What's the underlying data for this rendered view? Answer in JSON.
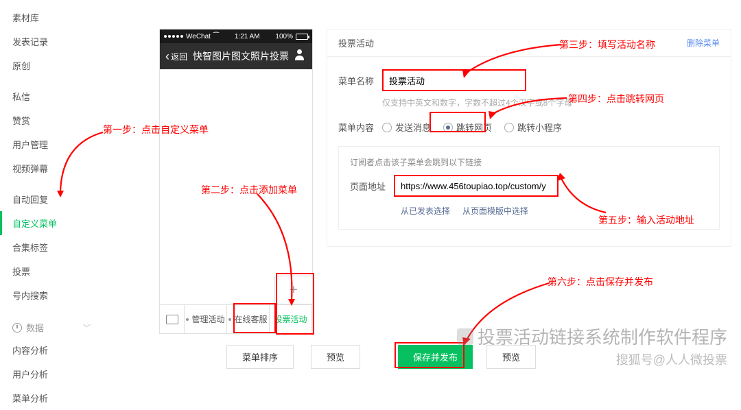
{
  "sidebar": {
    "items": [
      {
        "label": "素材库"
      },
      {
        "label": "发表记录"
      },
      {
        "label": "原创"
      },
      {
        "label": "私信"
      },
      {
        "label": "赞赏"
      },
      {
        "label": "用户管理"
      },
      {
        "label": "视频弹幕"
      },
      {
        "label": "自动回复"
      },
      {
        "label": "自定义菜单"
      },
      {
        "label": "合集标签"
      },
      {
        "label": "投票"
      },
      {
        "label": "号内搜索"
      }
    ],
    "data_section": "数据",
    "data_items": [
      {
        "label": "内容分析"
      },
      {
        "label": "用户分析"
      },
      {
        "label": "菜单分析"
      }
    ]
  },
  "phone": {
    "carrier": "WeChat",
    "time": "1:21 AM",
    "battery": "100%",
    "back": "返回",
    "title": "快智图片图文照片投票",
    "menu_items": [
      "管理活动",
      "在线客服",
      "投票活动"
    ],
    "plus": "+"
  },
  "panel": {
    "title": "投票活动",
    "delete": "删除菜单",
    "name_label": "菜单名称",
    "name_value": "投票活动",
    "name_hint": "仅支持中英文和数字，字数不超过4个汉字或8个字母",
    "content_label": "菜单内容",
    "radio_send": "发送消息",
    "radio_jump": "跳转网页",
    "radio_mini": "跳转小程序",
    "link_hint": "订阅者点击该子菜单会跳到以下链接",
    "url_label": "页面地址",
    "url_value": "https://www.456toupiao.top/custom/y",
    "action_published": "从已发表选择",
    "action_template": "从页面模版中选择"
  },
  "buttons": {
    "sort": "菜单排序",
    "preview": "预览",
    "save": "保存并发布",
    "preview2": "预览"
  },
  "annotations": {
    "step1": "第一步：点击自定义菜单",
    "step2": "第二步：点击添加菜单",
    "step3": "第三步：填写活动名称",
    "step4": "第四步：点击跳转网页",
    "step5": "第五步：输入活动地址",
    "step6": "第六步：点击保存并发布"
  },
  "watermark": {
    "top": "投票活动链接系统制作软件程序",
    "bottom": "搜狐号@人人微投票"
  }
}
